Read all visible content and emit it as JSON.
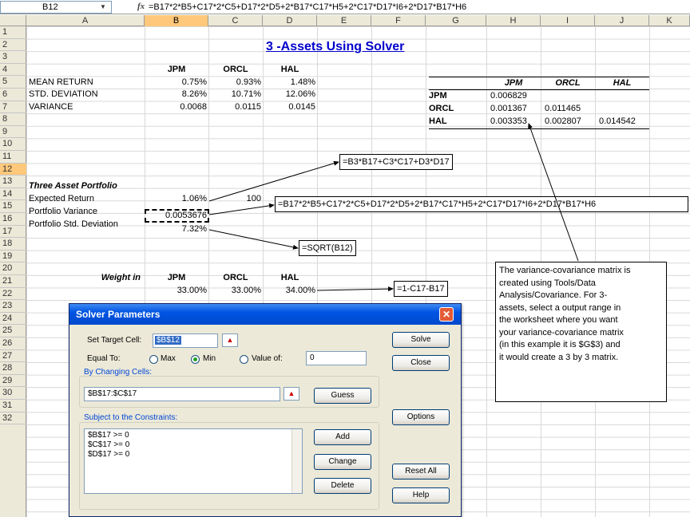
{
  "formula_bar": {
    "name_box": "B12",
    "dropdown_glyph": "▼",
    "fx_label": "fx",
    "formula": "=B17*2*B5+C17*2*C5+D17*2*D5+2*B17*C17*H5+2*C17*D17*I6+2*D17*B17*H6"
  },
  "columns": [
    "A",
    "B",
    "C",
    "D",
    "E",
    "F",
    "G",
    "H",
    "I",
    "J",
    "K"
  ],
  "rows": [
    "1",
    "2",
    "3",
    "4",
    "5",
    "6",
    "7",
    "8",
    "9",
    "10",
    "11",
    "12",
    "13",
    "14",
    "15",
    "16",
    "17",
    "18",
    "19",
    "20",
    "21",
    "22",
    "23",
    "24",
    "25",
    "26",
    "27",
    "28",
    "29",
    "30",
    "31",
    "32"
  ],
  "sheet": {
    "title": "3 -Assets Using Solver",
    "hdr_jpm": "JPM",
    "hdr_orcl": "ORCL",
    "hdr_hal": "HAL",
    "mean_label": "MEAN RETURN",
    "mean": [
      "0.75%",
      "0.93%",
      "1.48%"
    ],
    "std_label": "STD. DEVIATION",
    "std": [
      "8.26%",
      "10.71%",
      "12.06%"
    ],
    "var_label": "VARIANCE",
    "var": [
      "0.0068",
      "0.0115",
      "0.0145"
    ],
    "portfolio_title": "Three Asset Portfolio",
    "exp_label": "Expected Return",
    "exp_value": "1.06%",
    "exp_extra": "100",
    "pvar_label": "Portfolio Variance",
    "pvar_value": "0.0053676",
    "pstd_label": "Portfolio Std. Deviation",
    "pstd_value": "7.32%",
    "weight_label": "Weight in",
    "weights": [
      "33.00%",
      "33.00%",
      "34.00%"
    ]
  },
  "matrix": {
    "headers": [
      "JPM",
      "ORCL",
      "HAL"
    ],
    "row_labels": [
      "JPM",
      "ORCL",
      "HAL"
    ],
    "r1": [
      "0.006829"
    ],
    "r2": [
      "0.001367",
      "0.011465"
    ],
    "r3": [
      "0.003353",
      "0.002807",
      "0.014542"
    ]
  },
  "annotations": {
    "expected_formula": "=B3*B17+C3*C17+D3*D17",
    "variance_formula": "=B17*2*B5+C17*2*C5+D17*2*D5+2*B17*C17*H5+2*C17*D17*I6+2*D17*B17*H6",
    "std_formula": "=SQRT(B12)",
    "hal_weight_formula": "=1-C17-B17",
    "note_lines": [
      "The variance-covariance matrix is",
      "created using Tools/Data",
      "Analysis/Covariance. For 3-",
      "assets, select a output range in",
      "the worksheet where you want",
      "your variance-covariance matrix",
      "(in this example it is $G$3) and",
      "it would create a 3 by 3 matrix."
    ]
  },
  "dialog": {
    "title": "Solver Parameters",
    "close_glyph": "✕",
    "target_label": "Set Target Cell:",
    "target_value": "$B$12",
    "equal_label": "Equal To:",
    "opt_max": "Max",
    "opt_min": "Min",
    "opt_value": "Value of:",
    "value_of": "0",
    "changing_label": "By Changing Cells:",
    "changing_value": "$B$17:$C$17",
    "constraints_label": "Subject to the Constraints:",
    "constraints": [
      "$B$17 >= 0",
      "$C$17 >= 0",
      "$D$17 >= 0"
    ],
    "buttons": {
      "solve": "Solve",
      "close": "Close",
      "guess": "Guess",
      "options": "Options",
      "add": "Add",
      "change": "Change",
      "delete": "Delete",
      "reset": "Reset All",
      "help": "Help"
    }
  }
}
